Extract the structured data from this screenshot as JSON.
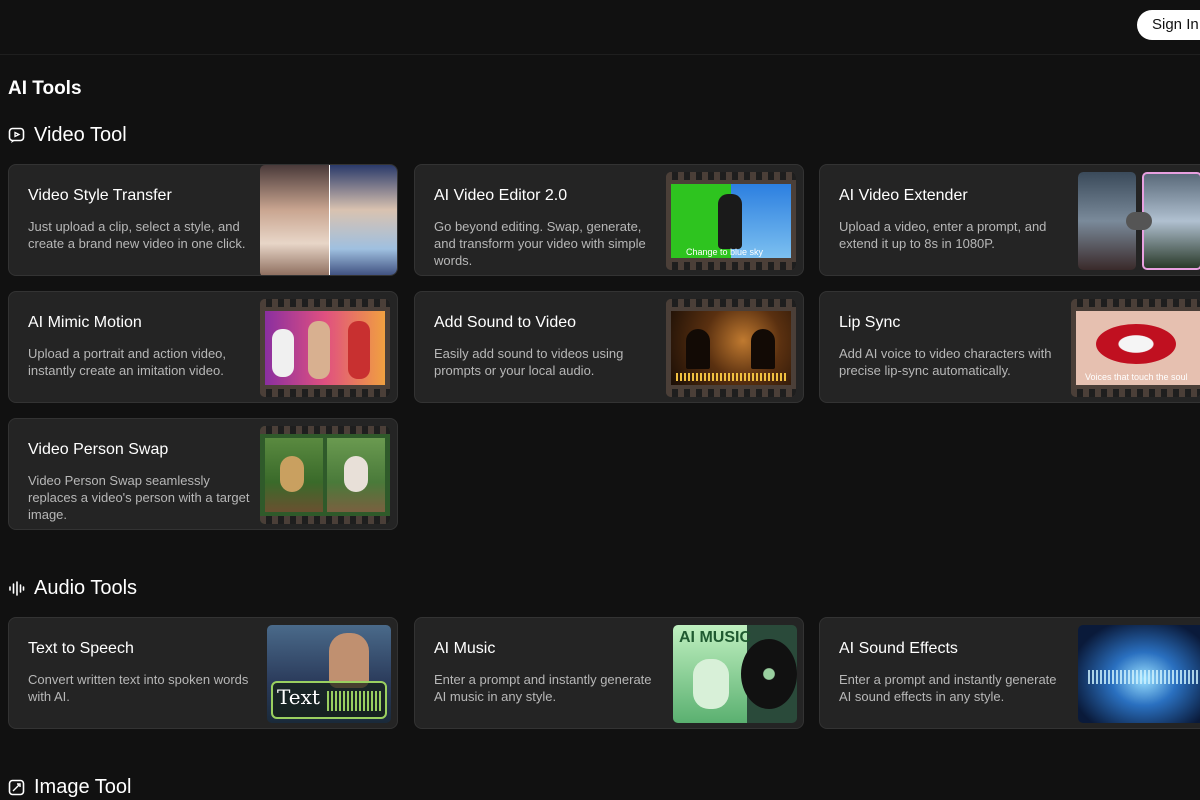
{
  "header": {
    "sign_in_label": "Sign In"
  },
  "page_title": "AI Tools",
  "sections": {
    "video": {
      "title": "Video Tool",
      "icon": "video-chat-icon"
    },
    "audio": {
      "title": "Audio Tools",
      "icon": "audio-wave-icon"
    },
    "image": {
      "title": "Image Tool",
      "icon": "image-edit-icon"
    }
  },
  "video_tools": [
    {
      "title": "Video Style Transfer",
      "desc": "Just upload a clip, select a style, and create a brand new video in one click."
    },
    {
      "title": "AI Video Editor 2.0",
      "desc": "Go beyond editing. Swap, generate, and transform your video with simple words.",
      "thumb_caption": "Change to blue sky"
    },
    {
      "title": "AI Video Extender",
      "desc": "Upload a video, enter a prompt, and extend it up to 8s in 1080P."
    },
    {
      "title": "AI Mimic Motion",
      "desc": "Upload a portrait and action video, instantly create an imitation video."
    },
    {
      "title": "Add Sound to Video",
      "desc": "Easily add sound to videos using prompts or your local audio."
    },
    {
      "title": "Lip Sync",
      "desc": "Add AI voice to video characters with precise lip-sync automatically.",
      "thumb_caption": "Voices that touch the soul"
    },
    {
      "title": "Video Person Swap",
      "desc": "Video Person Swap seamlessly replaces a video's person with a target image."
    }
  ],
  "audio_tools": [
    {
      "title": "Text to Speech",
      "desc": "Convert written text into spoken words with AI.",
      "thumb_caption": "Text"
    },
    {
      "title": "AI Music",
      "desc": "Enter a prompt and instantly generate AI music in any style.",
      "thumb_caption": "AI MUSIC"
    },
    {
      "title": "AI Sound Effects",
      "desc": "Enter a prompt and instantly generate AI sound effects in any style."
    }
  ],
  "colors": {
    "background": "#111111",
    "card": "#242424",
    "card_border": "#333333",
    "desc_text": "#b7b7b7"
  }
}
